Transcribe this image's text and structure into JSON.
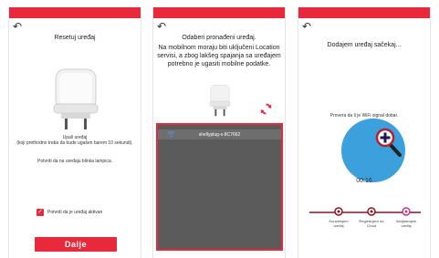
{
  "colors": {
    "accent": "#e8293b",
    "blue": "#3ba0dc",
    "dark_list": "#5b5b5b"
  },
  "screen1": {
    "back_icon": "back-arrow-icon",
    "title": "Resetuj uređaj",
    "instruction1": "Upali uređaj",
    "instruction2": "(koji prethodno treba da bude ugašen barem 10 sekundi).",
    "instruction3": "Potvrdi da na uređaju blinka lampica.",
    "checkbox_label": "Potvrdi da je uređaj aktivan",
    "checkbox_checked": true,
    "next_button": "Dalje"
  },
  "screen2": {
    "back_icon": "back-arrow-icon",
    "title": "Odaberi pronađeni uređaj.",
    "info": "Na mobilnom moraju biti uključeni Location servisi, a zbog lakšeg spajanja sa uređajem potrebno je ugasiti mobilne podatke.",
    "refresh_icon": "refresh-icon",
    "devices": [
      {
        "name": "shellyplug-s-8C7662",
        "icon": "wifi-icon"
      }
    ]
  },
  "screen3": {
    "back_icon": "back-arrow-icon",
    "title": "Dodajem uređaj sačekaj...",
    "wifi_check": "Provera da li je WiFi signal dobar.",
    "timer": "00:16",
    "steps": [
      {
        "label_line1": "Konektujem",
        "label_line2": "uređaj"
      },
      {
        "label_line1": "Registrujem na",
        "label_line2": "Cloud"
      },
      {
        "label_line1": "Inicijalizujem",
        "label_line2": "uređaj"
      }
    ]
  }
}
